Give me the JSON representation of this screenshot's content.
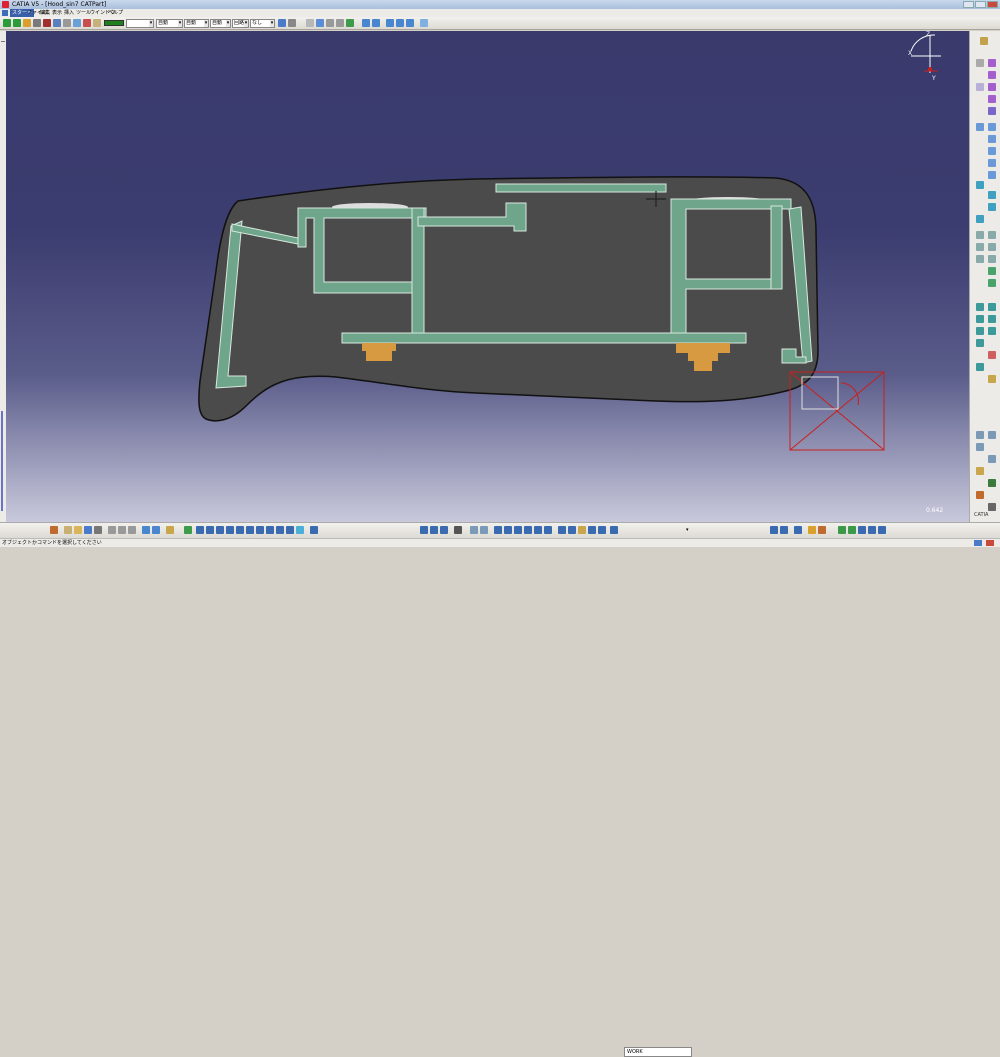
{
  "window": {
    "title": "CATIA V5 - [Hood_sin7 CATPart]",
    "buttons": [
      "minimize",
      "maximize",
      "close"
    ]
  },
  "menubar": {
    "items": [
      {
        "label": "スタート",
        "active": true
      },
      {
        "label": "ファイル"
      },
      {
        "label": "編集"
      },
      {
        "label": "表示"
      },
      {
        "label": "挿入"
      },
      {
        "label": "ツール"
      },
      {
        "label": "ウインドウ"
      },
      {
        "label": "ヘルプ"
      }
    ]
  },
  "toolbar": {
    "color_swatch": "#1f7f1f",
    "dropdowns": {
      "transparency": "自動",
      "linetype": "自動",
      "thickness": "自動",
      "layer_prefix": "回路",
      "layer": "なし"
    }
  },
  "viewport": {
    "background_top": "#3a3a6d",
    "background_bottom": "#c9c9dc",
    "section_fill": "#4b4b4b",
    "rib_fill": "#6fa58a",
    "clip_fill": "#d89a40",
    "compass_color": "#ffffff",
    "zoom_readout": "0.642",
    "axis_labels": {
      "x": "X",
      "y": "Y",
      "z": "Z"
    }
  },
  "bottom_toolbar": {
    "work_field": "WORK"
  },
  "status": {
    "message": "オブジェクトかコマンドを選択してください"
  },
  "right_toolbar": {
    "catia_logo": "CATIA"
  }
}
